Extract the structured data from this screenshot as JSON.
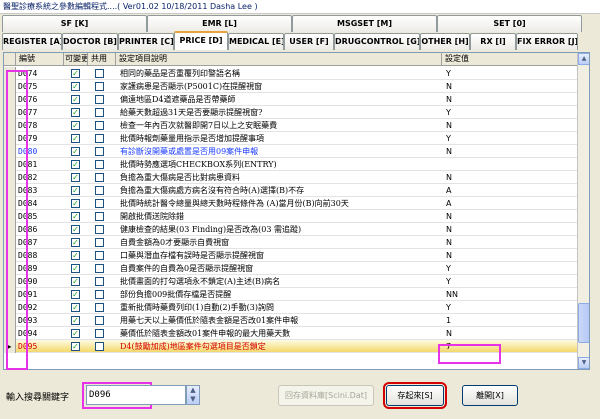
{
  "window": {
    "title": "醫聖診療系統之參數編輯程式....( Ver01.02 10/18/2011 Dasha Lee )"
  },
  "tabs_top": [
    {
      "label": "SF [K]"
    },
    {
      "label": "EMR [L]"
    },
    {
      "label": "MSGSET [M]"
    },
    {
      "label": "SET [0]"
    }
  ],
  "tabs_main": [
    {
      "label": "REGISTER [A]"
    },
    {
      "label": "DOCTOR [B]"
    },
    {
      "label": "PRINTER [C]"
    },
    {
      "label": "PRICE [D]",
      "active": true
    },
    {
      "label": "MEDICAL [E]"
    },
    {
      "label": "USER [F]"
    },
    {
      "label": "DRUGCONTROL [G]"
    },
    {
      "label": "OTHER [H]"
    },
    {
      "label": "RX [I]"
    },
    {
      "label": "FIX ERROR [J]"
    }
  ],
  "grid": {
    "headers": [
      "編號",
      "可變更",
      "共用",
      "設定項目說明",
      "設定值"
    ],
    "rows": [
      {
        "code": "D074",
        "c1": true,
        "c2": false,
        "desc": "相同的藥品是否重覆列印警語名稱",
        "value": "Y"
      },
      {
        "code": "D075",
        "c1": true,
        "c2": false,
        "desc": "家護病患是否顯示(P5001C)在提醒視窗",
        "value": "N"
      },
      {
        "code": "D076",
        "c1": true,
        "c2": false,
        "desc": "偏遠地區D4道遮藥品是否帶藥師",
        "value": "N"
      },
      {
        "code": "D077",
        "c1": true,
        "c2": false,
        "desc": "給藥天數超過31天是否要顯示提醒視窗?",
        "value": "Y"
      },
      {
        "code": "D078",
        "c1": true,
        "c2": false,
        "desc": "檢查一年內百次就醫即開7日以上之安眠藥費",
        "value": "N"
      },
      {
        "code": "D079",
        "c1": true,
        "c2": false,
        "desc": "批價時報劑藥量用指示是否增加提醒事項",
        "value": "Y"
      },
      {
        "code": "D080",
        "c1": true,
        "c2": false,
        "desc": "有診斷沒開藥或處置是否用09案件申報",
        "value": "N",
        "blue": true
      },
      {
        "code": "D081",
        "c1": true,
        "c2": false,
        "desc": "批價時勢應選項CHECKBOX系列(ENTRY)",
        "value": ""
      },
      {
        "code": "D082",
        "c1": true,
        "c2": false,
        "desc": "負擔為重大傷病是否比對病患資料",
        "value": "N"
      },
      {
        "code": "D083",
        "c1": true,
        "c2": false,
        "desc": "負擔為重大傷病處方病名沒有符合時(A)選擇(B)不存",
        "value": "A"
      },
      {
        "code": "D084",
        "c1": true,
        "c2": false,
        "desc": "批價時統計醫令總量與總天數時程條件為 (A)當月份(B)向前30天",
        "value": "A"
      },
      {
        "code": "D085",
        "c1": true,
        "c2": false,
        "desc": "開啟批價送院除錯",
        "value": "N"
      },
      {
        "code": "D086",
        "c1": true,
        "c2": false,
        "desc": "健康檢查的結果(03 Finding)是否改為(03 需追蹤)",
        "value": "N"
      },
      {
        "code": "D087",
        "c1": true,
        "c2": false,
        "desc": "自費金額為0才要顯示自費視窗",
        "value": "N"
      },
      {
        "code": "D088",
        "c1": true,
        "c2": false,
        "desc": "口藥與潛血存檔有誤時是否顯示提醒視窗",
        "value": "N"
      },
      {
        "code": "D089",
        "c1": true,
        "c2": false,
        "desc": "自費案件的自費為0是否顯示提醒視窗",
        "value": "Y"
      },
      {
        "code": "D090",
        "c1": true,
        "c2": false,
        "desc": "批價畫面的打勾選項永不鎖定(A)主述(B)病名",
        "value": "Y"
      },
      {
        "code": "D091",
        "c1": true,
        "c2": false,
        "desc": "部份負擔009批價存檔是否提醒",
        "value": "NN"
      },
      {
        "code": "D092",
        "c1": true,
        "c2": false,
        "desc": "重新批價時藥費列印(1)自動(2)手動(3)詢問",
        "value": "Y"
      },
      {
        "code": "D093",
        "c1": true,
        "c2": false,
        "desc": "用藥七天以上藥價低於隨表金額是否改01案件申報",
        "value": "1"
      },
      {
        "code": "D094",
        "c1": true,
        "c2": false,
        "desc": "藥價低於隨表金額改01案件申報的最大用藥天數",
        "value": "N"
      },
      {
        "code": "D095",
        "c1": true,
        "c2": false,
        "desc": "D4(鼓勵加成)地區案件勾選項目是否鎖定",
        "value": "7",
        "sel": true
      }
    ],
    "selected_value": "Y",
    "selected_code": "D096"
  },
  "footer": {
    "search_label": "輸入搜尋關鍵字",
    "search_value": "D096",
    "restore_button": "回存資料庫[Scini.Dat]",
    "save_button": "存起來[S]",
    "exit_button": "離開[X]"
  },
  "colors": {
    "highlight": "#e832e8",
    "save_outline": "#d40000"
  }
}
